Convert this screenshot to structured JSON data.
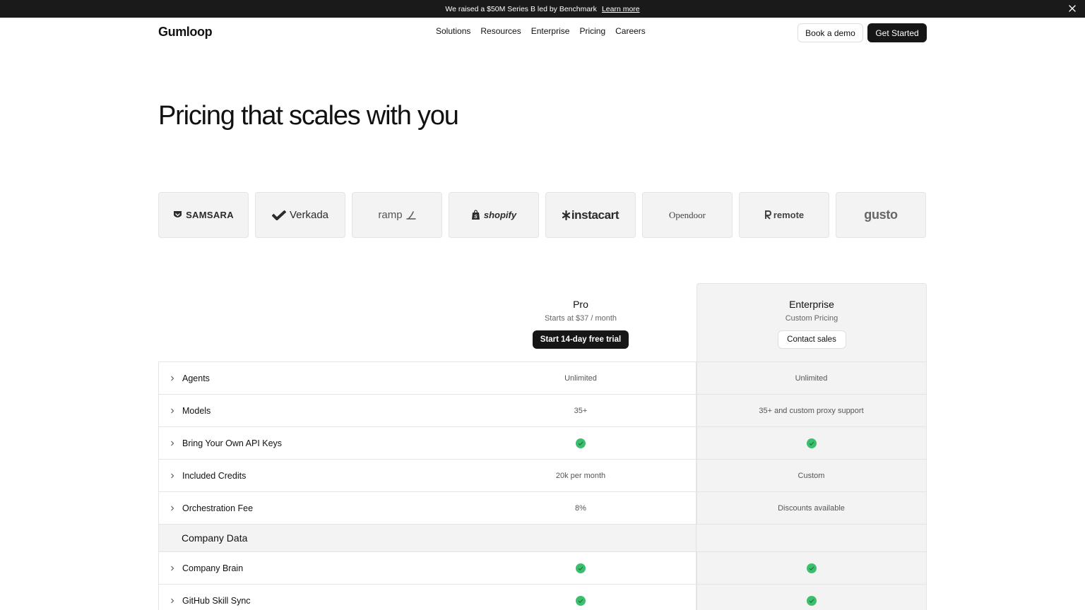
{
  "announcement": {
    "text": "We raised a $50M Series B led by Benchmark",
    "link": "Learn more"
  },
  "header": {
    "logo": "Gumloop",
    "nav": [
      "Solutions",
      "Resources",
      "Enterprise",
      "Pricing",
      "Careers"
    ],
    "demo_label": "Book a demo",
    "start_label": "Get Started"
  },
  "hero": {
    "title": "Pricing that scales with you"
  },
  "logos": [
    "SAMSARA",
    "Verkada",
    "ramp",
    "shopify",
    "instacart",
    "Opendoor",
    "remote",
    "gusto"
  ],
  "plans": {
    "pro": {
      "name": "Pro",
      "sub": "Starts at $37 / month",
      "button": "Start 14-day free trial"
    },
    "enterprise": {
      "name": "Enterprise",
      "sub": "Custom Pricing",
      "button": "Contact sales"
    }
  },
  "features": [
    {
      "label": "Agents",
      "pro": "Unlimited",
      "enterprise": "Unlimited"
    },
    {
      "label": "Models",
      "pro": "35+",
      "enterprise": "35+ and custom proxy support"
    },
    {
      "label": "Bring Your Own API Keys",
      "pro": "check",
      "enterprise": "check"
    },
    {
      "label": "Included Credits",
      "pro": "20k per month",
      "enterprise": "Custom"
    },
    {
      "label": "Orchestration Fee",
      "pro": "8%",
      "enterprise": "Discounts available"
    }
  ],
  "section": {
    "title": "Company Data"
  },
  "company_features": [
    {
      "label": "Company Brain",
      "pro": "check",
      "enterprise": "check"
    },
    {
      "label": "GitHub Skill Sync",
      "pro": "check",
      "enterprise": "check"
    }
  ],
  "colors": {
    "check": "#3bbf6e",
    "dark": "#161616",
    "panel": "#f3f3f4"
  }
}
